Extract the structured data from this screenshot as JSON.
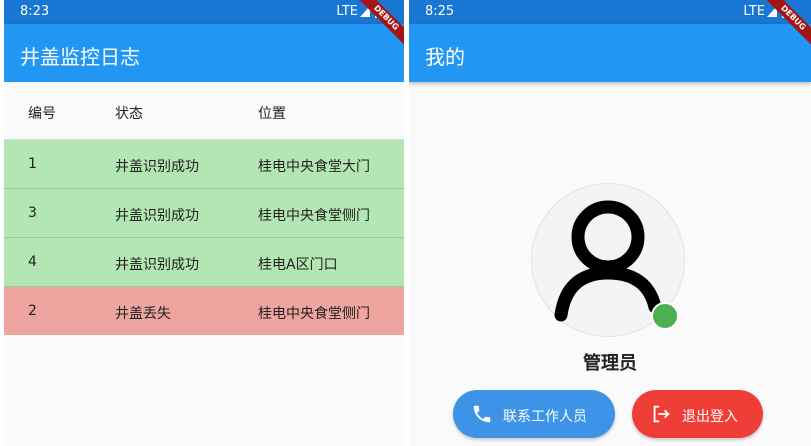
{
  "left_screen": {
    "status_time": "8:23",
    "status_network": "LTE",
    "title": "井盖监控日志",
    "debug_label": "DEBUG",
    "table": {
      "headers": [
        "编号",
        "状态",
        "位置"
      ],
      "rows": [
        {
          "id": "1",
          "status": "井盖识别成功",
          "location": "桂电中央食堂大门",
          "state": "ok"
        },
        {
          "id": "3",
          "status": "井盖识别成功",
          "location": "桂电中央食堂侧门",
          "state": "ok"
        },
        {
          "id": "4",
          "status": "井盖识别成功",
          "location": "桂电A区门口",
          "state": "ok"
        },
        {
          "id": "2",
          "status": "井盖丢失",
          "location": "桂电中央食堂侧门",
          "state": "lost"
        }
      ]
    }
  },
  "right_screen": {
    "status_time": "8:25",
    "status_network": "LTE",
    "title": "我的",
    "debug_label": "DEBUG",
    "profile": {
      "name": "管理员",
      "avatar_icon": "person-icon",
      "online_color": "#4caf50"
    },
    "buttons": {
      "contact_label": "联系工作人员",
      "contact_icon": "phone-icon",
      "contact_color": "#3d93e8",
      "logout_label": "退出登入",
      "logout_icon": "logout-icon",
      "logout_color": "#ef3e38"
    }
  }
}
